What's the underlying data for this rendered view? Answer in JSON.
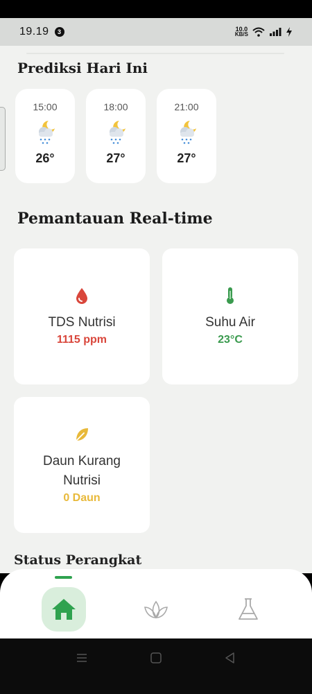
{
  "status_bar": {
    "time": "19.19",
    "notification_count": "3",
    "net_speed_value": "10.0",
    "net_speed_unit": "KB/S"
  },
  "forecast": {
    "title": "Prediksi Hari Ini",
    "items": [
      {
        "time": "15:00",
        "temp": "26°",
        "icon": "night-rain-icon"
      },
      {
        "time": "18:00",
        "temp": "27°",
        "icon": "night-rain-icon"
      },
      {
        "time": "21:00",
        "temp": "27°",
        "icon": "night-rain-icon"
      }
    ]
  },
  "monitoring": {
    "title": "Pemantauan Real-time",
    "cards": [
      {
        "label": "TDS Nutrisi",
        "value": "1115 ppm",
        "icon": "drop-icon",
        "color": "#d9463b"
      },
      {
        "label": "Suhu Air",
        "value": "23°C",
        "icon": "thermometer-icon",
        "color": "#3a9a4e"
      },
      {
        "label": "Daun Kurang Nutrisi",
        "value": "0 Daun",
        "icon": "leaf-icon",
        "color": "#e8b93a"
      }
    ]
  },
  "next_section": {
    "title": "Status Perangkat"
  },
  "bottom_nav": {
    "items": [
      {
        "name": "home",
        "icon": "home-icon",
        "active": true
      },
      {
        "name": "plant",
        "icon": "plant-icon",
        "active": false
      },
      {
        "name": "lab",
        "icon": "flask-icon",
        "active": false
      }
    ],
    "accent": "#2fa24f"
  }
}
